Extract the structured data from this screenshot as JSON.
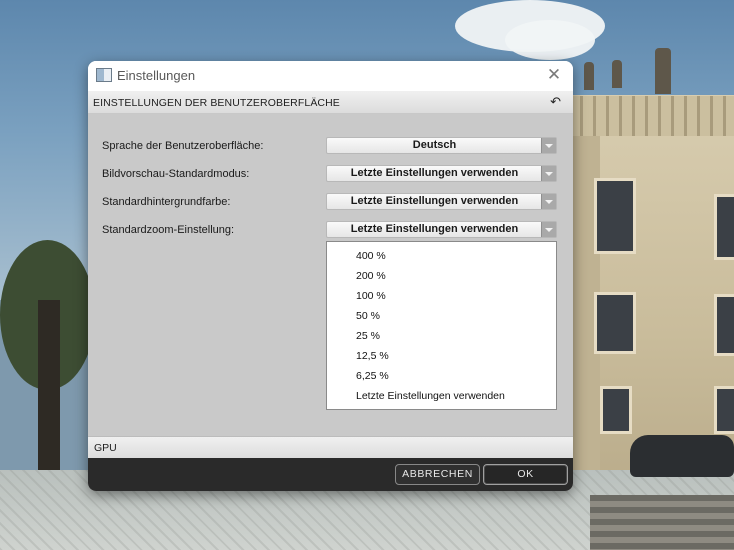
{
  "dialog": {
    "title": "Einstellungen",
    "close_symbol": "✕",
    "section_title": "EINSTELLUNGEN DER BENUTZEROBERFLÄCHE",
    "reset_symbol": "↶",
    "icons": {
      "app": "app-window-icon",
      "close": "close-icon",
      "reset": "undo-icon"
    }
  },
  "settings": [
    {
      "label": "Sprache der Benutzeroberfläche:",
      "value": "Deutsch"
    },
    {
      "label": "Bildvorschau-Standardmodus:",
      "value": "Letzte Einstellungen verwenden"
    },
    {
      "label": "Standardhintergrundfarbe:",
      "value": "Letzte Einstellungen verwenden"
    },
    {
      "label": "Standardzoom-Einstellung:",
      "value": "Letzte Einstellungen verwenden"
    }
  ],
  "zoom_dropdown": {
    "options": [
      "400 %",
      "200 %",
      "100 %",
      "50 %",
      "25 %",
      "12,5 %",
      "6,25 %",
      "Letzte Einstellungen verwenden"
    ]
  },
  "gpu_section": {
    "label": "GPU"
  },
  "buttons": {
    "cancel": "ABBRECHEN",
    "ok": "OK"
  },
  "colors": {
    "footer": "#2a2a2a",
    "content": "#c9c9c9",
    "dropdown": "#ffffff"
  }
}
